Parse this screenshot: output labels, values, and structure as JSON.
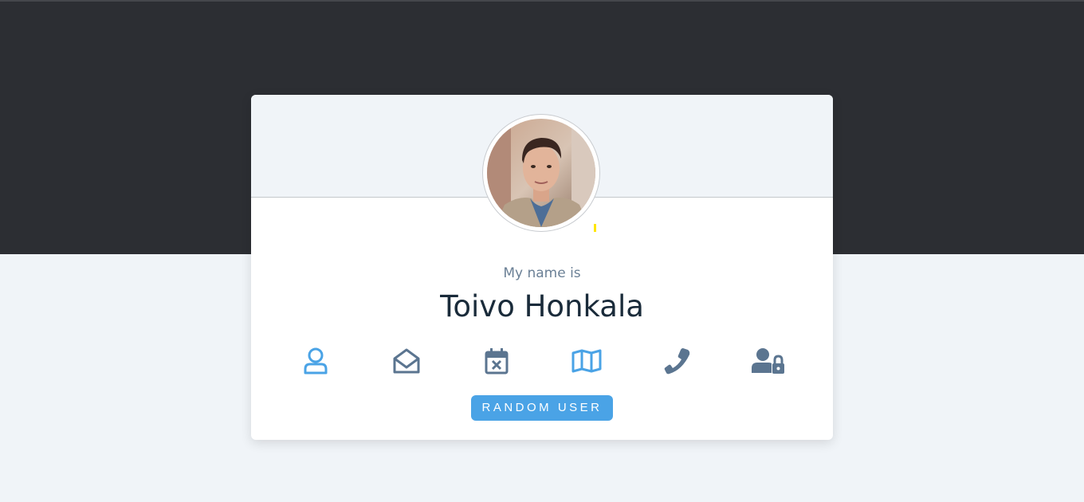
{
  "colors": {
    "dark_band": "#2c2e33",
    "page_background": "#f0f4f8",
    "active_icon": "#4aa3e6",
    "inactive_icon": "#5b7590",
    "button": "#4aa3e6"
  },
  "user": {
    "title": "My name is",
    "value": "Toivo Honkala",
    "avatar": "user-photo"
  },
  "icons": [
    {
      "name": "user-icon",
      "active": true
    },
    {
      "name": "envelope-open-icon",
      "active": false
    },
    {
      "name": "calendar-x-icon",
      "active": false
    },
    {
      "name": "map-icon",
      "active": false
    },
    {
      "name": "phone-icon",
      "active": false
    },
    {
      "name": "user-lock-icon",
      "active": false
    }
  ],
  "button": {
    "label": "RANDOM USER"
  }
}
